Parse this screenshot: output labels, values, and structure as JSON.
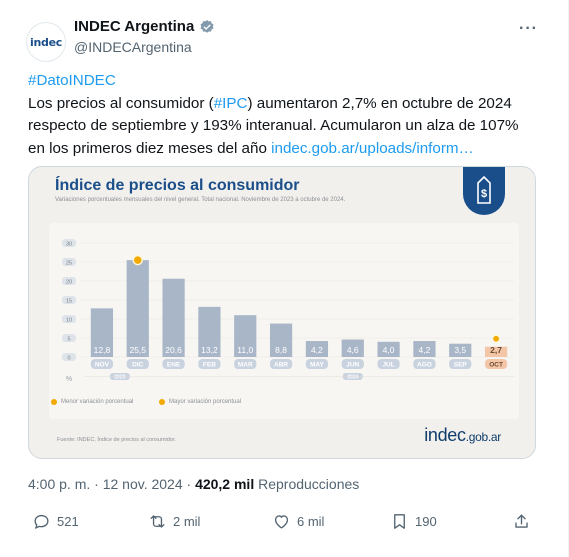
{
  "author": {
    "avatar_text": "indec",
    "display_name": "INDEC Argentina",
    "handle": "@INDECArgentina",
    "more": "···"
  },
  "tweet": {
    "hashtag": "#DatoINDEC",
    "body_1": "Los precios al consumidor (",
    "hashtag_ipc": "#IPC",
    "body_2": ") aumentaron 2,7% en octubre de 2024 respecto de septiembre y 193% interanual. Acumularon un alza de 107% en los primeros diez meses del año ",
    "link": "indec.gob.ar/uploads/inform…"
  },
  "media": {
    "title": "Índice de precios al consumidor",
    "subtitle": "Variaciones porcentuales mensuales del nivel general. Total nacional. Noviembre de 2023 a octubre de 2024.",
    "legend_min": "Menor variación porcentual",
    "legend_max": "Mayor variación porcentual",
    "source": "Fuente: INDEC, Índice de precios al consumidor.",
    "brand_main": "indec",
    "brand_suffix": ".gob.ar"
  },
  "chart_data": {
    "type": "bar",
    "title": "Índice de precios al consumidor",
    "categories": [
      "NOV",
      "DIC",
      "ENE",
      "FEB",
      "MAR",
      "ABR",
      "MAY",
      "JUN",
      "JUL",
      "AGO",
      "SEP",
      "OCT"
    ],
    "values": [
      12.8,
      25.5,
      20.6,
      13.2,
      11.0,
      8.8,
      4.2,
      4.6,
      4.0,
      4.2,
      3.5,
      2.7
    ],
    "value_labels": [
      "12,8",
      "25,5",
      "20,6",
      "13,2",
      "11,0",
      "8,8",
      "4,2",
      "4,6",
      "4,0",
      "4,2",
      "3,5",
      "2,7"
    ],
    "year_labels": [
      "2023",
      "2024"
    ],
    "y_unit": "%",
    "yticks": [
      0,
      5,
      10,
      15,
      20,
      25,
      30
    ],
    "ylim": [
      0,
      30
    ],
    "max_marker": "DIC",
    "min_marker": "OCT",
    "colors": {
      "bar": "#a9b6c8",
      "highlight": "#f3c6a8",
      "marker": "#f2a900",
      "axis_pill": "#c9d3df"
    }
  },
  "footer": {
    "timestamp": "4:00 p. m. · 12 nov. 2024 · ",
    "views_count": "420,2 mil",
    "views_label": " Reproducciones"
  },
  "actions": {
    "replies": "521",
    "reposts": "2 mil",
    "likes": "6 mil",
    "bookmarks": "190"
  }
}
